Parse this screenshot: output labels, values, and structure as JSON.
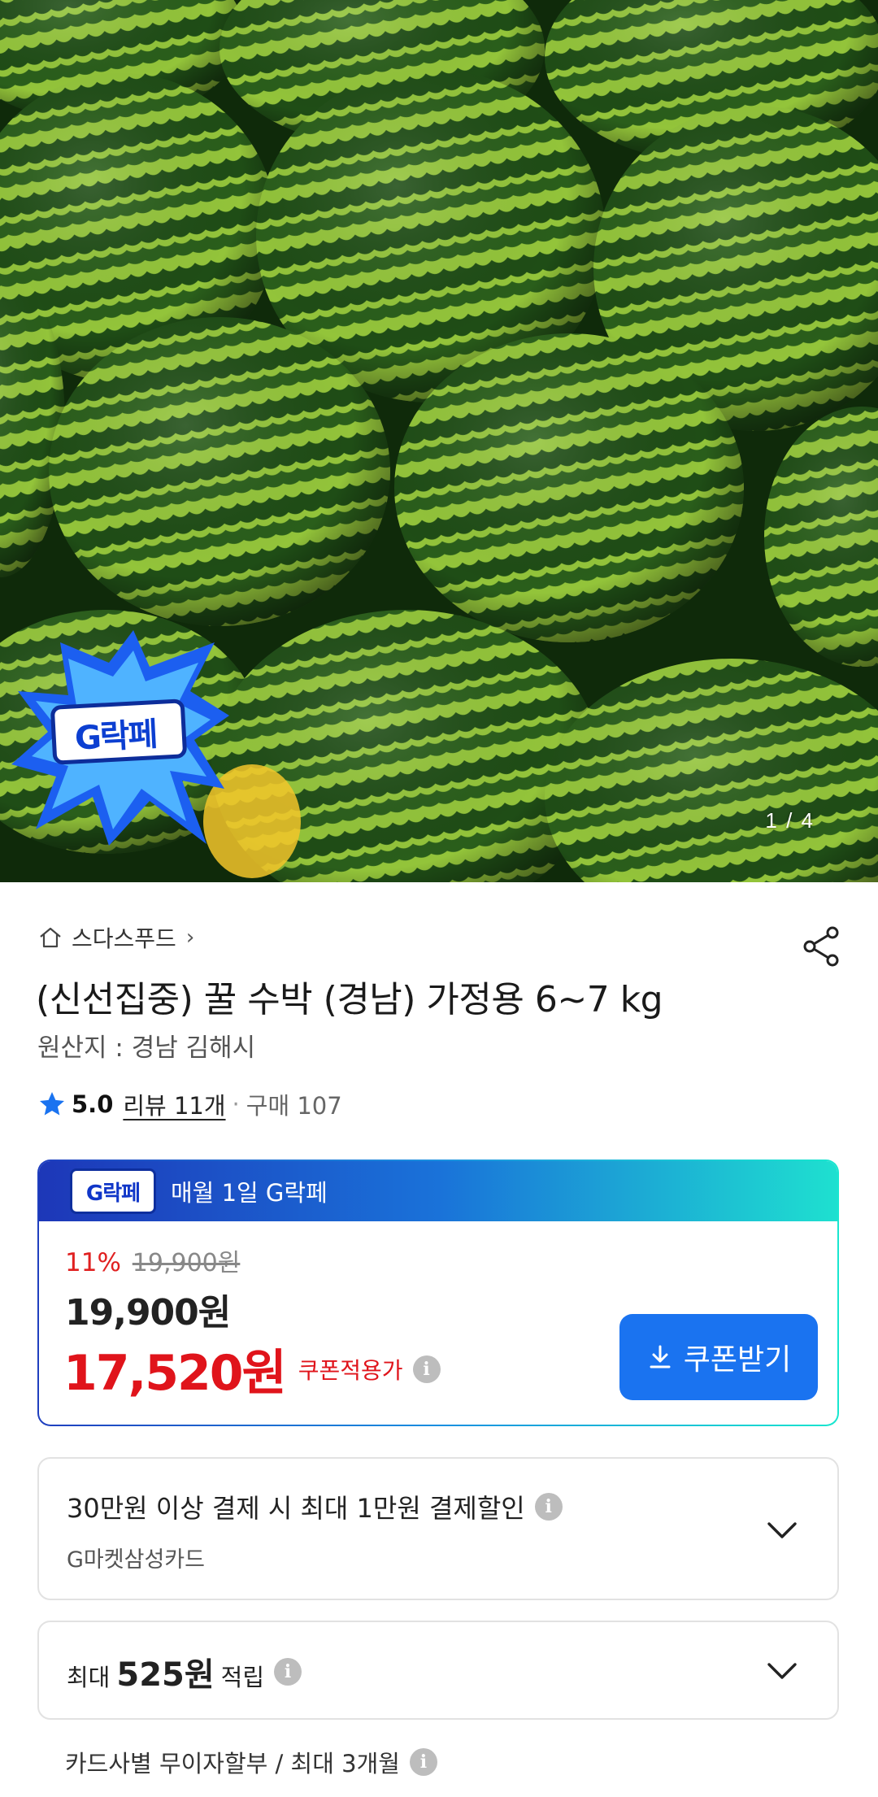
{
  "gallery": {
    "counter": "1 / 4",
    "badge_text": "G락페"
  },
  "product": {
    "store_name": "스다스푸드",
    "title": "(신선집중) 꿀 수박 (경남) 가정용 6~7 kg",
    "origin": "원산지 : 경남 김해시",
    "rating": "5.0",
    "review_link": "리뷰 11개",
    "purchase_count": "구매 107"
  },
  "coupon_card": {
    "logo_text": "G락페",
    "banner_text": "매월 1일 G락페",
    "discount_pct": "11%",
    "original_price": "19,900원",
    "price": "19,900원",
    "coupon_price": "17,520원",
    "coupon_label": "쿠폰적용가",
    "coupon_button": "쿠폰받기"
  },
  "card_discount": {
    "text": "30만원 이상 결제 시 최대 1만원 결제할인",
    "card_name": "G마켓삼성카드"
  },
  "points": {
    "prefix": "최대",
    "amount": "525원",
    "suffix": "적립"
  },
  "installment": {
    "text": "카드사별 무이자할부 / 최대 3개월"
  },
  "colors": {
    "accent_blue": "#1a73f0",
    "price_red": "#e0141b",
    "star_blue": "#1a73f0"
  }
}
